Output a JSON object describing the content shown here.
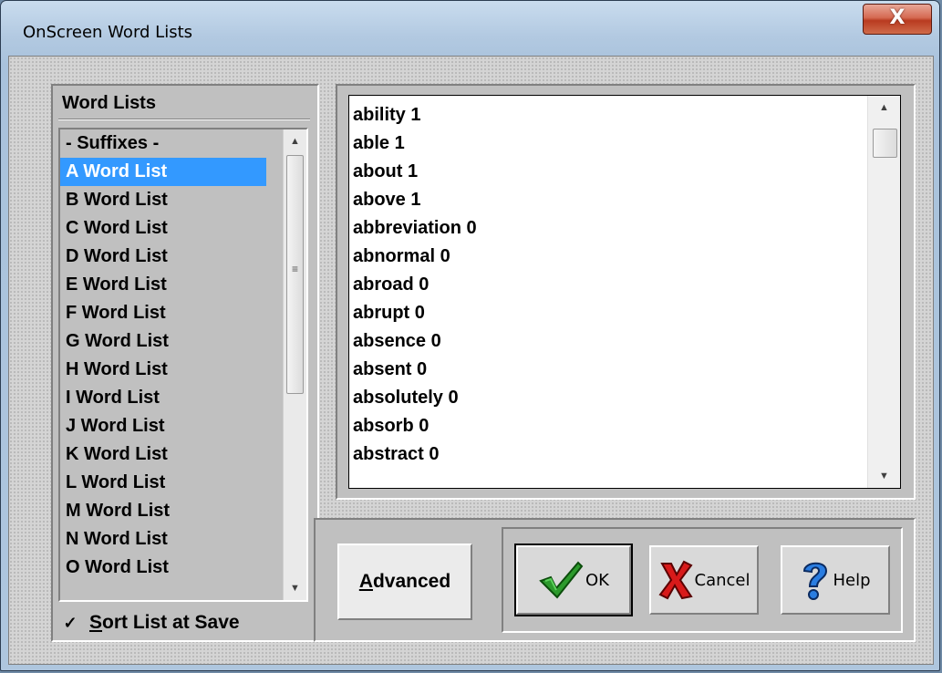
{
  "window": {
    "title": "OnScreen Word Lists",
    "close_label": "X"
  },
  "word_lists": {
    "heading": "Word Lists",
    "items": [
      "- Suffixes -",
      "A Word List",
      "B Word List",
      "C Word List",
      "D Word List",
      "E Word List",
      "F Word List",
      "G Word List",
      "H Word List",
      "I Word List",
      "J Word List",
      "K Word List",
      "L Word List",
      "M Word List",
      "N Word List",
      "O Word List"
    ],
    "selected": "A Word List",
    "sort_checkbox": {
      "checked": true,
      "mark": "✓",
      "label_first": "S",
      "label_rest": "ort List at Save"
    }
  },
  "words": [
    "ability 1",
    "able 1",
    "about 1",
    "above 1",
    "abbreviation 0",
    "abnormal 0",
    "abroad 0",
    "abrupt 0",
    "absence 0",
    "absent 0",
    "absolutely 0",
    "absorb 0",
    "abstract 0"
  ],
  "buttons": {
    "advanced": {
      "first": "A",
      "rest": "dvanced"
    },
    "ok": "OK",
    "cancel": "Cancel",
    "help": "Help"
  },
  "icons": {
    "scroll_up": "triangle-up-icon",
    "scroll_down": "triangle-down-icon",
    "ok": "green-checkmark-icon",
    "cancel": "red-x-icon",
    "help": "blue-question-mark-icon"
  },
  "colors": {
    "selection": "#3399ff",
    "close_button": "#c84a31",
    "dialog_gray": "#c0c0c0"
  }
}
